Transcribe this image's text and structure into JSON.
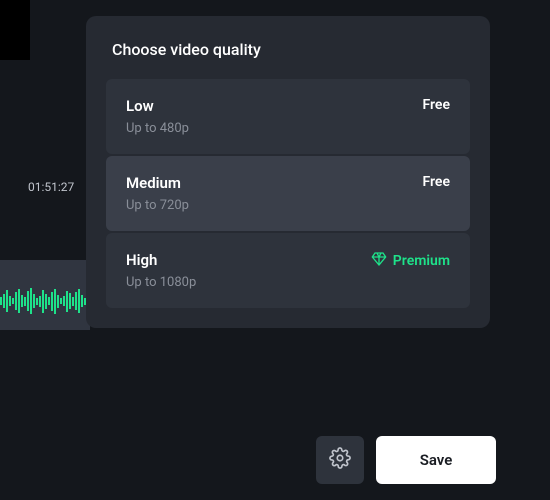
{
  "modal": {
    "title": "Choose video quality",
    "options": [
      {
        "label": "Low",
        "desc": "Up to 480p",
        "badge": "Free",
        "premium": false
      },
      {
        "label": "Medium",
        "desc": "Up to 720p",
        "badge": "Free",
        "premium": false
      },
      {
        "label": "High",
        "desc": "Up to 1080p",
        "badge": "Premium",
        "premium": true
      }
    ],
    "selected_index": 1
  },
  "timeline": {
    "timestamp": "01:51:27"
  },
  "footer": {
    "save_label": "Save"
  },
  "colors": {
    "premium": "#1ee28a",
    "modal_bg": "#262a32",
    "option_bg": "#2e333c",
    "option_selected_bg": "#3a3f4a"
  }
}
